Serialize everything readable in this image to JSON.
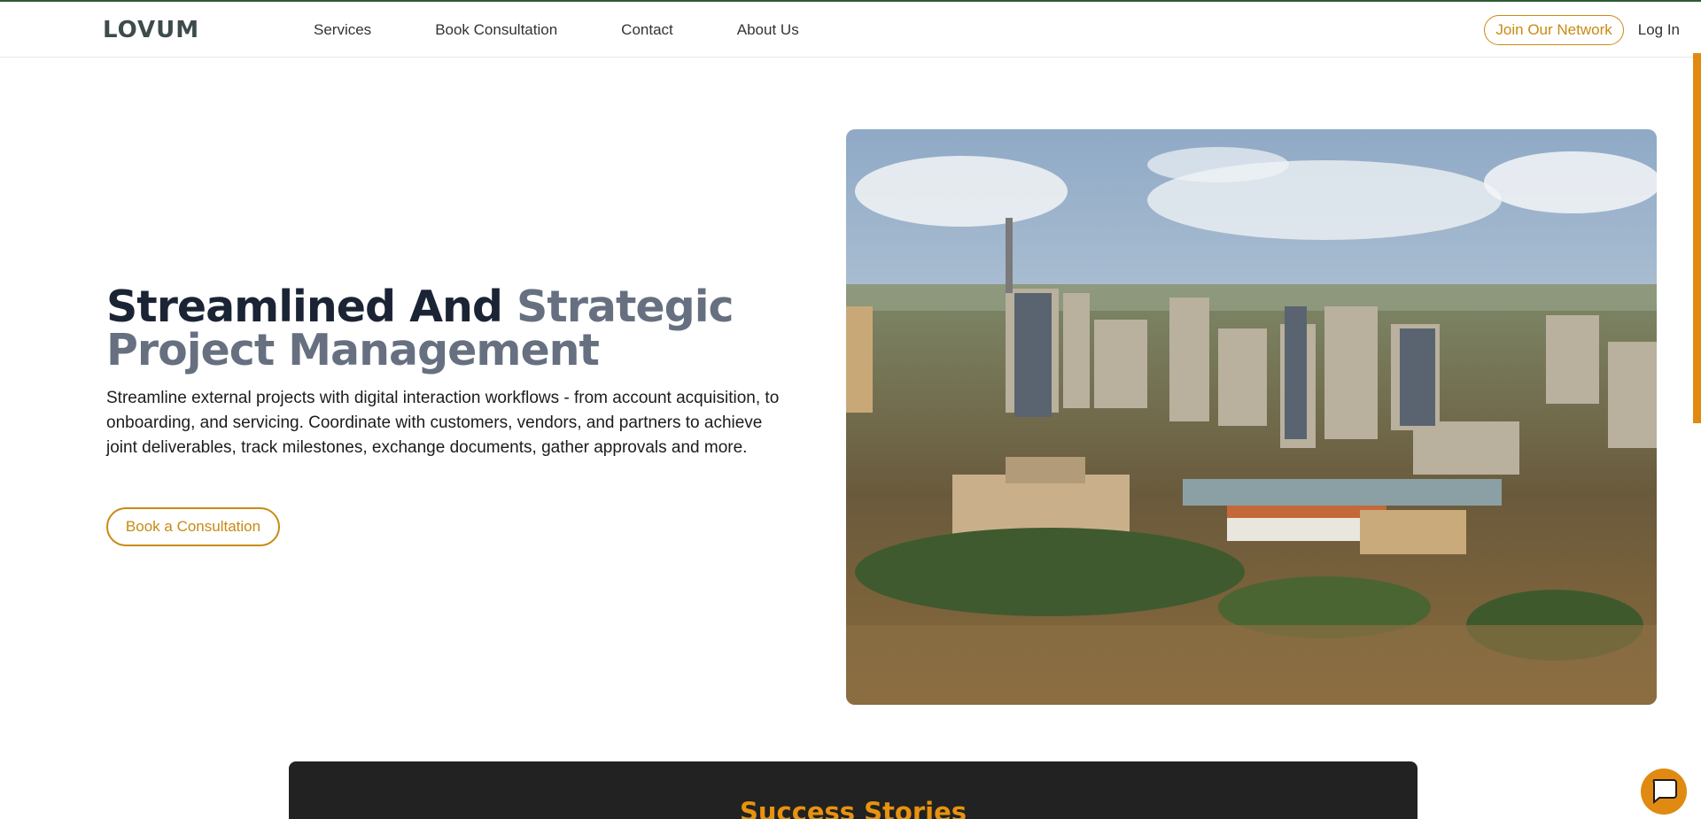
{
  "brand": {
    "logo_text": "LOVUM",
    "accent_color": "#c98a12",
    "dark_color": "#1b2435"
  },
  "nav": {
    "links": [
      "Services",
      "Book Consultation",
      "Contact",
      "About Us"
    ],
    "join_label": "Join Our Network",
    "login_label": "Log In"
  },
  "hero": {
    "title_part1": "Streamlined And ",
    "title_part2": "Strategic Project Management",
    "description": "Streamline external projects with digital interaction workflows - from account acquisition, to onboarding, and servicing. Coordinate with customers, vendors, and partners to achieve joint deliverables, track milestones, exchange documents, gather approvals and more.",
    "cta_label": "Book a Consultation",
    "image_icon": "city-skyline-photo"
  },
  "stories": {
    "title": "Success Stories"
  },
  "chat": {
    "icon": "chat-bubble-icon"
  }
}
